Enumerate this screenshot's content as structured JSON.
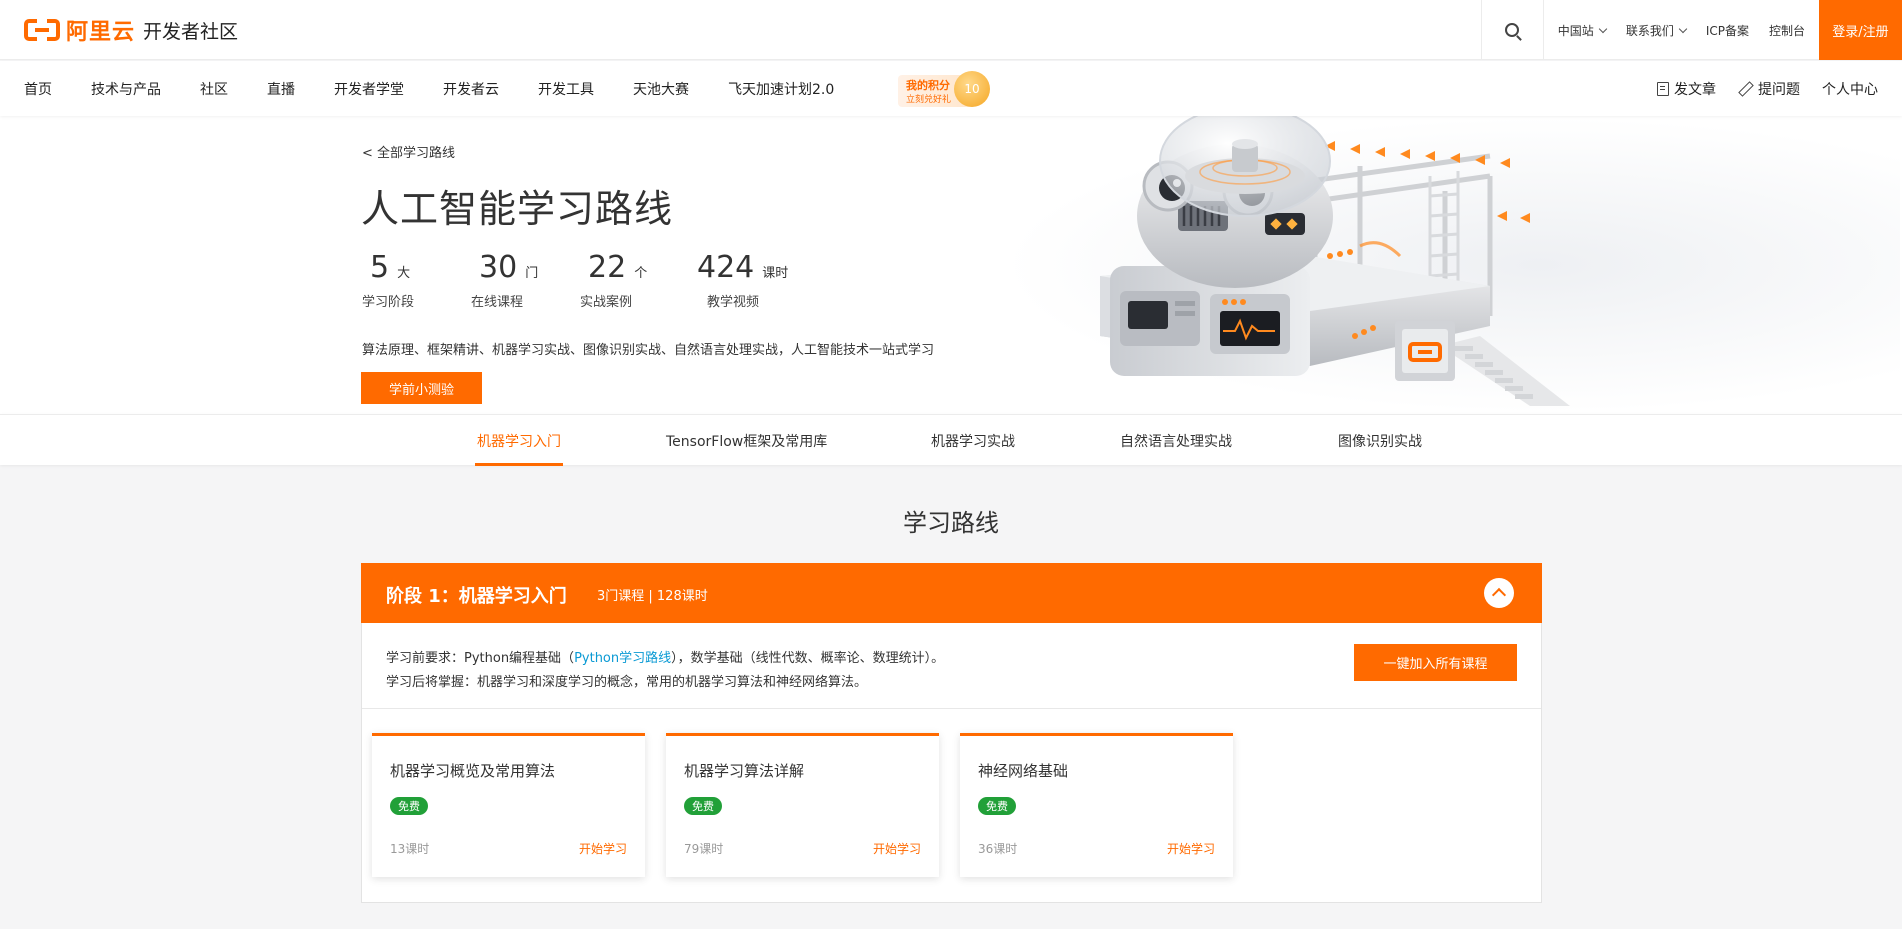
{
  "header": {
    "logo_text": "阿里云",
    "site_name": "开发者社区",
    "links": [
      {
        "label": "中国站",
        "dropdown": true
      },
      {
        "label": "联系我们",
        "dropdown": true
      },
      {
        "label": "ICP备案",
        "dropdown": false
      },
      {
        "label": "控制台",
        "dropdown": false
      }
    ],
    "login_label": "登录/注册"
  },
  "nav": {
    "items": [
      "首页",
      "技术与产品",
      "社区",
      "直播",
      "开发者学堂",
      "开发者云",
      "开发工具",
      "天池大赛",
      "飞天加速计划2.0"
    ],
    "points": {
      "title": "我的积分",
      "subtitle": "立刻兑好礼",
      "value": "10"
    },
    "right": {
      "write_article": "发文章",
      "ask_question": "提问题",
      "personal_center": "个人中心"
    }
  },
  "hero": {
    "back_link": "< 全部学习路线",
    "title": "人工智能学习路线",
    "stats": [
      {
        "value": "5",
        "unit": "大",
        "label": "学习阶段"
      },
      {
        "value": "30",
        "unit": "门",
        "label": "在线课程"
      },
      {
        "value": "22",
        "unit": "个",
        "label": "实战案例"
      },
      {
        "value": "424",
        "unit": "课时",
        "label": "教学视频"
      }
    ],
    "description": "算法原理、框架精讲、机器学习实战、图像识别实战、自然语言处理实战，人工智能技术一站式学习",
    "quiz_button": "学前小测验"
  },
  "tabs": [
    "机器学习入门",
    "TensorFlow框架及常用库",
    "机器学习实战",
    "自然语言处理实战",
    "图像识别实战"
  ],
  "route": {
    "section_title": "学习路线",
    "stage": {
      "name": "阶段 1：机器学习入门",
      "meta": "3门课程 | 128课时",
      "req_prefix": "学习前要求：Python编程基础（",
      "req_link": "Python学习路线",
      "req_suffix": "），数学基础（线性代数、概率论、数理统计）。",
      "after_learning": "学习后将掌握：机器学习和深度学习的概念，常用的机器学习算法和神经网络算法。",
      "join_button": "一键加入所有课程",
      "courses": [
        {
          "title": "机器学习概览及常用算法",
          "badge": "免费",
          "hours": "13课时",
          "action": "开始学习"
        },
        {
          "title": "机器学习算法详解",
          "badge": "免费",
          "hours": "79课时",
          "action": "开始学习"
        },
        {
          "title": "神经网络基础",
          "badge": "免费",
          "hours": "36课时",
          "action": "开始学习"
        }
      ]
    }
  },
  "colors": {
    "accent": "#ff6a00",
    "free_badge": "#21a038",
    "link": "#0a9ad4"
  }
}
